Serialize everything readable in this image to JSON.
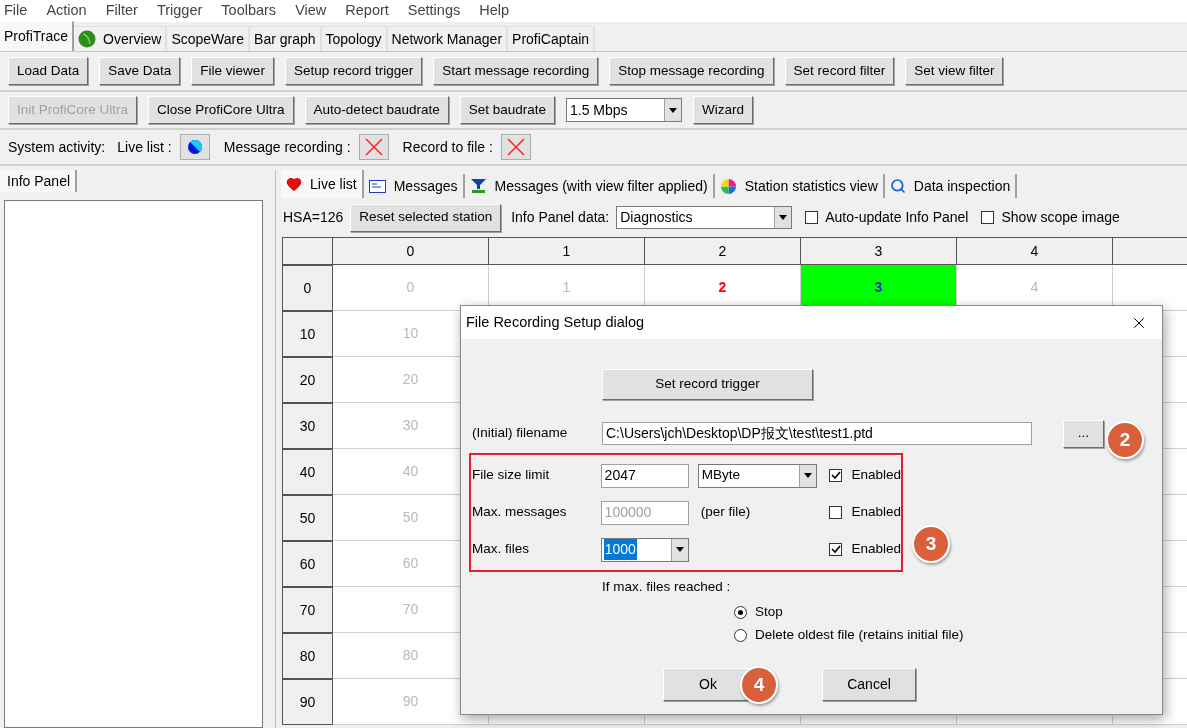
{
  "menu": [
    "File",
    "Action",
    "Filter",
    "Trigger",
    "Toolbars",
    "View",
    "Report",
    "Settings",
    "Help"
  ],
  "app_tabs": [
    {
      "label": "ProfiTrace",
      "selected": true
    },
    {
      "label": "Overview",
      "selected": false,
      "kind": "globe"
    },
    {
      "label": "ScopeWare",
      "selected": false
    },
    {
      "label": "Bar graph",
      "selected": false
    },
    {
      "label": "Topology",
      "selected": false
    },
    {
      "label": "Network Manager",
      "selected": false
    },
    {
      "label": "ProfiCaptain",
      "selected": false
    }
  ],
  "toolbar_1": [
    {
      "label": "Load Data",
      "disabled": false
    },
    {
      "label": "Save Data",
      "disabled": false
    },
    {
      "label": "File viewer",
      "disabled": false
    },
    {
      "label": "Setup record trigger",
      "disabled": false
    },
    {
      "label": "Start message recording",
      "disabled": false
    },
    {
      "label": "Stop message recording",
      "disabled": false
    },
    {
      "label": "Set record filter",
      "disabled": false
    },
    {
      "label": "Set view filter",
      "disabled": false
    }
  ],
  "toolbar_2": [
    {
      "kind": "button",
      "label": "Init ProfiCore Ultra",
      "disabled": true
    },
    {
      "kind": "button",
      "label": "Close ProfiCore Ultra",
      "disabled": false
    },
    {
      "kind": "button",
      "label": "Auto-detect baudrate",
      "disabled": false
    },
    {
      "kind": "button",
      "label": "Set baudrate",
      "disabled": false
    },
    {
      "kind": "select",
      "label": "1.5 Mbps",
      "disabled": false
    },
    {
      "kind": "button",
      "label": "Wizard",
      "disabled": false
    }
  ],
  "activity": {
    "label": "System activity:",
    "items": [
      {
        "label": "Live list :",
        "kind": "running"
      },
      {
        "label": "Message recording :",
        "kind": "stopped"
      },
      {
        "label": "Record to file :",
        "kind": "stopped"
      }
    ]
  },
  "info_panel": {
    "tab": "Info Panel"
  },
  "view_tabs": [
    {
      "label": "Live list",
      "selected": true,
      "kind": "heart"
    },
    {
      "label": "Messages",
      "selected": false,
      "kind": "messages"
    },
    {
      "label": "Messages (with view filter applied)",
      "selected": false,
      "kind": "filter"
    },
    {
      "label": "Station statistics view",
      "selected": false,
      "kind": "wheel"
    },
    {
      "label": "Data inspection",
      "selected": false,
      "kind": "search"
    }
  ],
  "options": {
    "hsa": "HSA=126",
    "reset_button": "Reset selected station",
    "data_label": "Info Panel data:",
    "data_select": "Diagnostics",
    "checkboxes": [
      {
        "label": "Auto-update Info Panel",
        "checked": false
      },
      {
        "label": "Show scope image",
        "checked": false
      }
    ]
  },
  "grid": {
    "columns": [
      "0",
      "1",
      "2",
      "3",
      "4"
    ],
    "rows": [
      {
        "header": "0",
        "cells": [
          {
            "text": "0",
            "kind": "absent"
          },
          {
            "text": "1",
            "kind": "absent"
          },
          {
            "text": "2",
            "kind": "error"
          },
          {
            "text": "3",
            "kind": "active"
          },
          {
            "text": "4",
            "kind": "absent"
          }
        ]
      },
      {
        "header": "10",
        "cells": [
          {
            "text": "10",
            "kind": "absent"
          }
        ]
      },
      {
        "header": "20",
        "cells": [
          {
            "text": "20",
            "kind": "absent"
          }
        ]
      },
      {
        "header": "30",
        "cells": [
          {
            "text": "30",
            "kind": "absent"
          }
        ]
      },
      {
        "header": "40",
        "cells": [
          {
            "text": "40",
            "kind": "absent"
          }
        ]
      },
      {
        "header": "50",
        "cells": [
          {
            "text": "50",
            "kind": "absent"
          }
        ]
      },
      {
        "header": "60",
        "cells": [
          {
            "text": "60",
            "kind": "absent"
          }
        ]
      },
      {
        "header": "70",
        "cells": [
          {
            "text": "70",
            "kind": "absent"
          }
        ]
      },
      {
        "header": "80",
        "cells": [
          {
            "text": "80",
            "kind": "absent"
          }
        ]
      },
      {
        "header": "90",
        "cells": [
          {
            "text": "90",
            "kind": "absent"
          }
        ]
      }
    ]
  },
  "dialog": {
    "title": "File Recording Setup dialog",
    "trigger_button": "Set record trigger",
    "filename": {
      "label": "(Initial) filename",
      "value": "C:\\Users\\jch\\Desktop\\DP报文\\test\\test1.ptd",
      "browse": "..."
    },
    "limits": [
      {
        "kind": "select_unit",
        "label": "File size limit",
        "value": "2047",
        "unit": "MByte",
        "disabled": false,
        "enabled_label": "Enabled",
        "checked": true
      },
      {
        "kind": "text_unit",
        "label": "Max. messages",
        "value": "100000",
        "unit": "(per file)",
        "disabled": true,
        "enabled_label": "Enabled",
        "checked": false
      },
      {
        "kind": "combo",
        "label": "Max. files",
        "value": "1000",
        "disabled": false,
        "enabled_label": "Enabled",
        "checked": true
      }
    ],
    "reached_label": "If max. files reached :",
    "radios": [
      {
        "label": "Stop",
        "selected": true
      },
      {
        "label": "Delete oldest file (retains initial file)",
        "selected": false
      }
    ],
    "ok": "Ok",
    "cancel": "Cancel"
  },
  "callouts": [
    "2",
    "3",
    "4"
  ]
}
